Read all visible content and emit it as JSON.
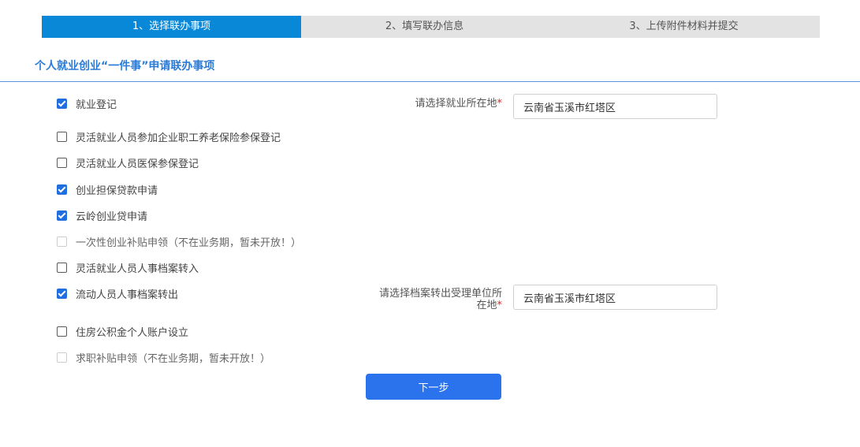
{
  "steps": [
    {
      "label": "1、选择联办事项",
      "active": true
    },
    {
      "label": "2、填写联办信息",
      "active": false
    },
    {
      "label": "3、上传附件材料并提交",
      "active": false
    }
  ],
  "page_title": "个人就业创业“一件事”申请联办事项",
  "items": [
    {
      "label": "就业登记",
      "checked": true,
      "disabled": false
    },
    {
      "label": "灵活就业人员参加企业职工养老保险参保登记",
      "checked": false,
      "disabled": false
    },
    {
      "label": "灵活就业人员医保参保登记",
      "checked": false,
      "disabled": false
    },
    {
      "label": "创业担保贷款申请",
      "checked": true,
      "disabled": false
    },
    {
      "label": "云岭创业贷申请",
      "checked": true,
      "disabled": false
    },
    {
      "label": "一次性创业补贴申领（不在业务期，暂未开放！）",
      "checked": false,
      "disabled": true
    },
    {
      "label": "灵活就业人员人事档案转入",
      "checked": false,
      "disabled": false
    },
    {
      "label": "流动人员人事档案转出",
      "checked": true,
      "disabled": false
    },
    {
      "label": "住房公积金个人账户设立",
      "checked": false,
      "disabled": false
    },
    {
      "label": "求职补贴申领（不在业务期，暂未开放！）",
      "checked": false,
      "disabled": true
    }
  ],
  "fields": {
    "employment_location": {
      "label": "请选择就业所在地",
      "required_mark": "*",
      "value": "云南省玉溪市红塔区"
    },
    "archive_location": {
      "label_line1": "请选择档案转出受理单位所",
      "label_line2": "在地",
      "required_mark": "*",
      "value": "云南省玉溪市红塔区"
    }
  },
  "next_button": "下一步"
}
